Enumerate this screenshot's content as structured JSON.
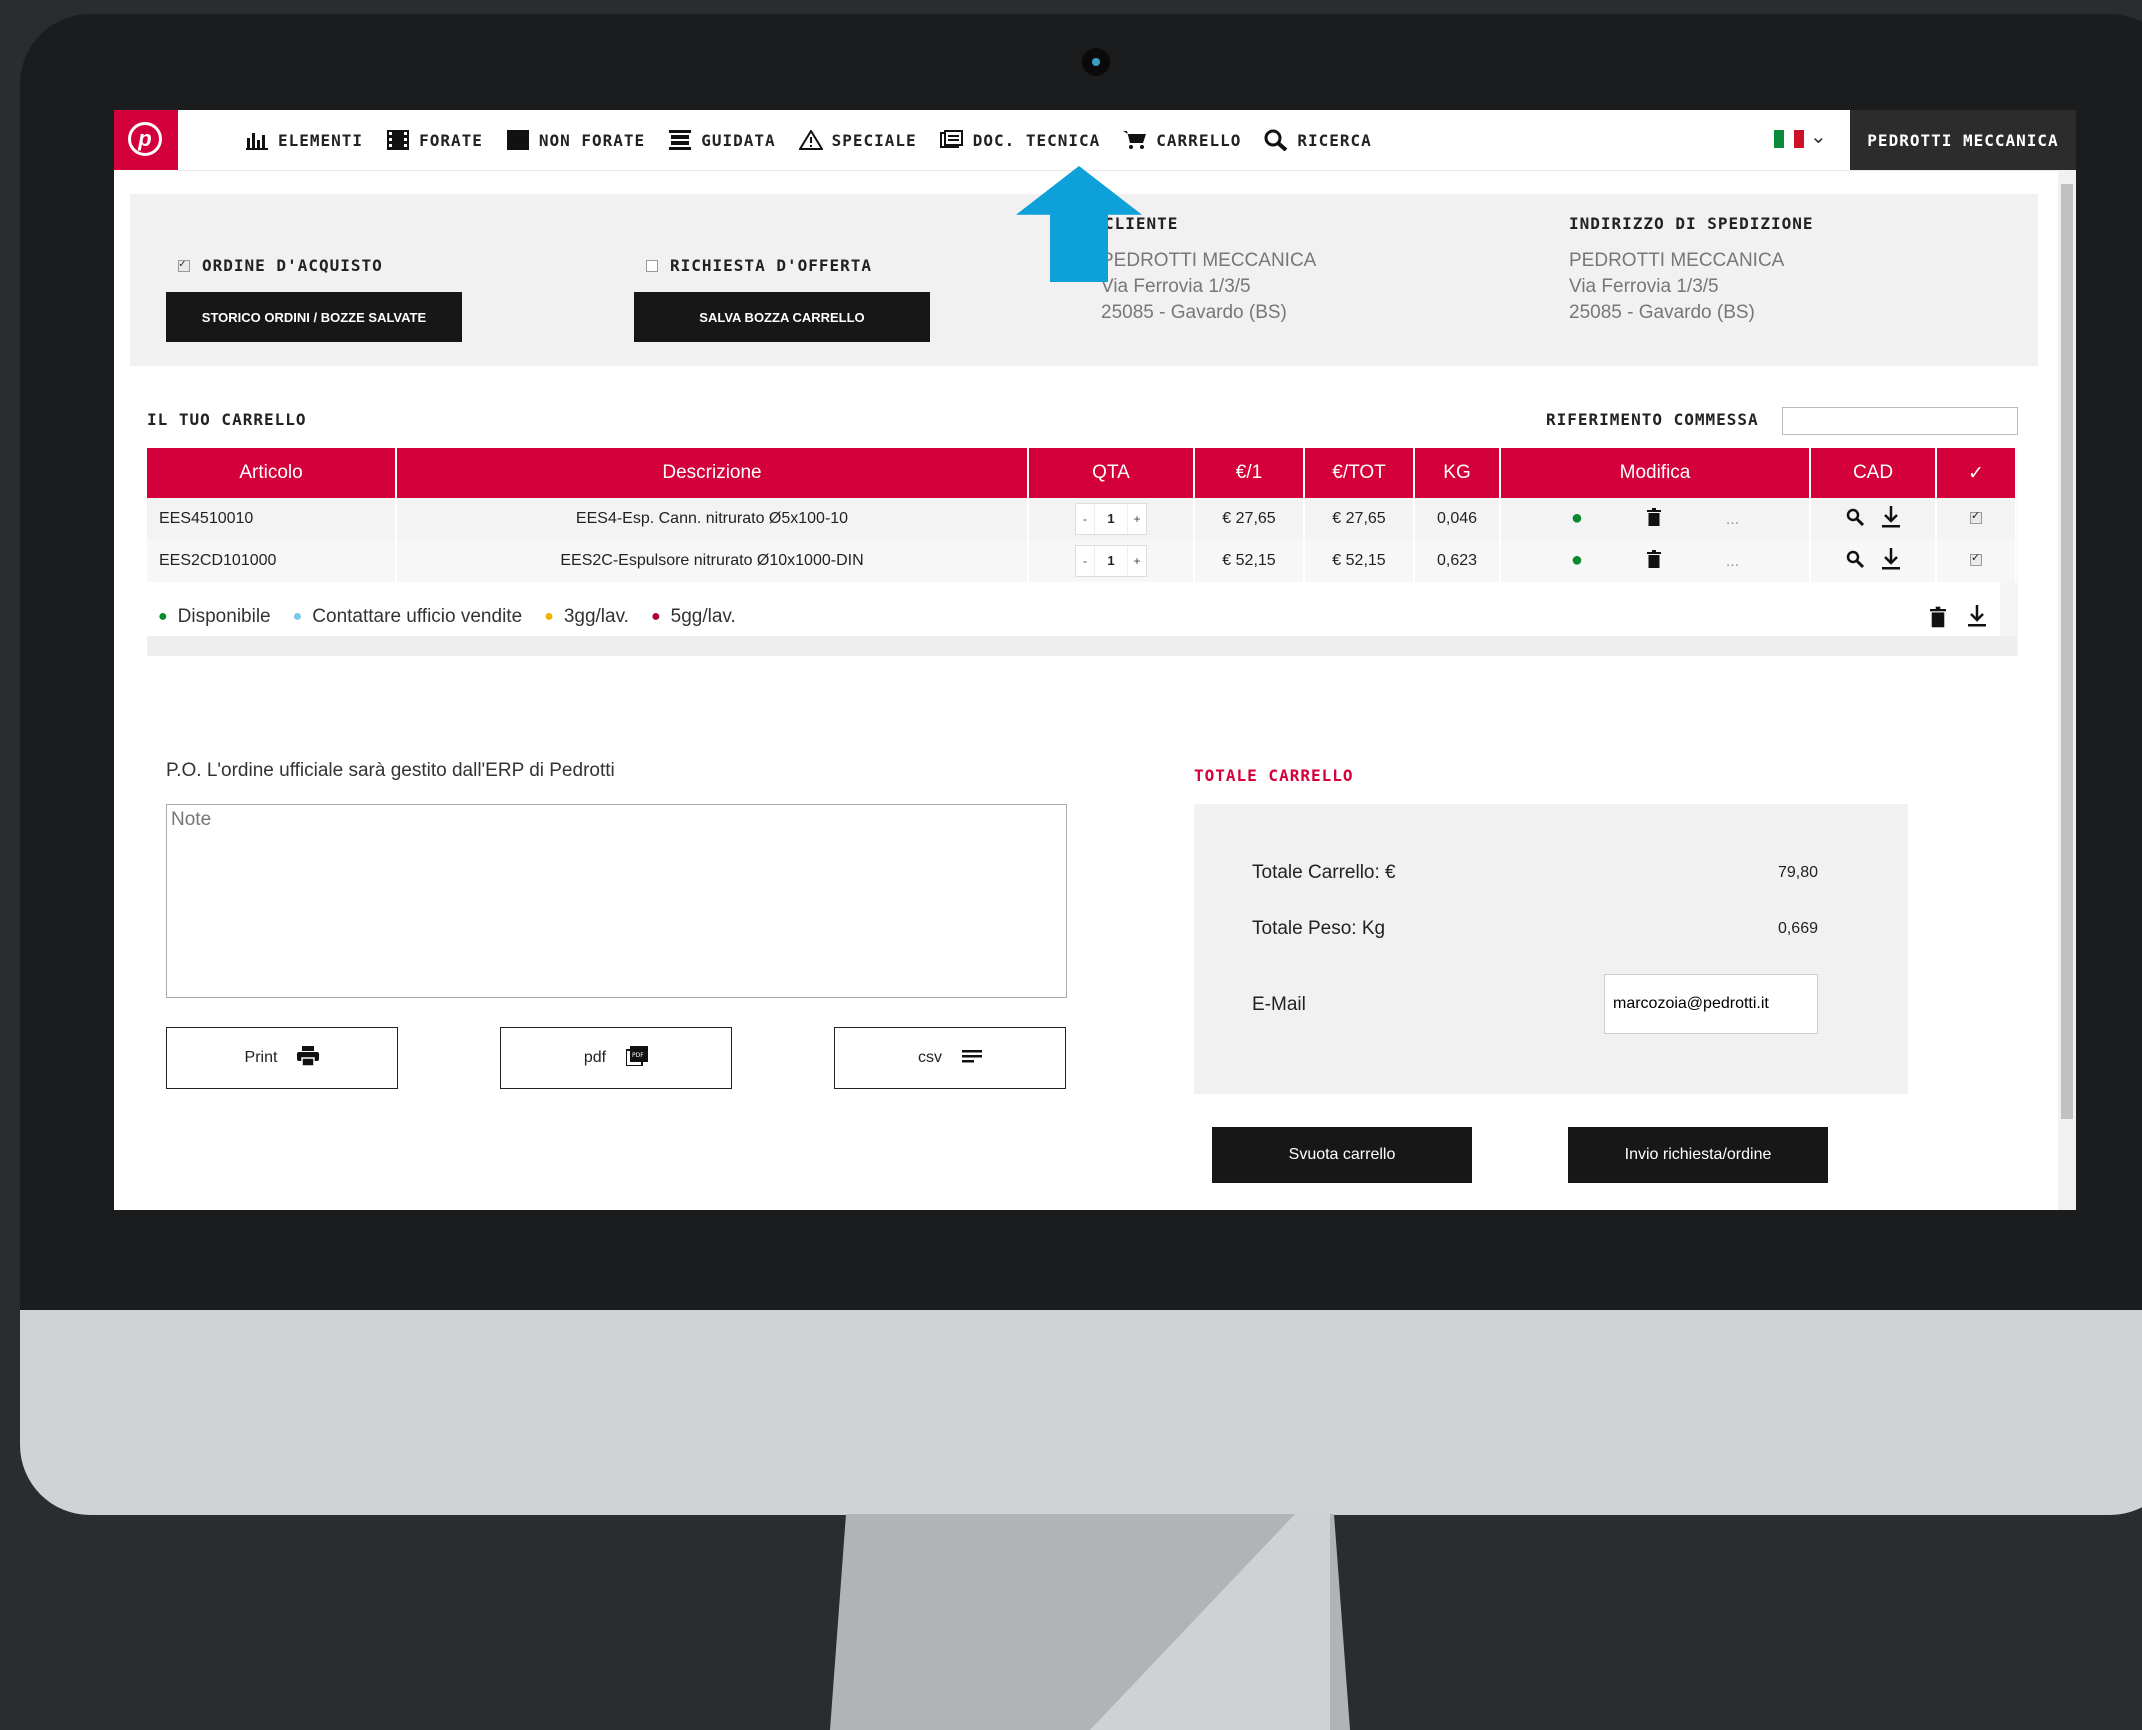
{
  "nav": {
    "items": [
      {
        "label": "Elementi",
        "icon": "chart-icon"
      },
      {
        "label": "Forate",
        "icon": "film-icon"
      },
      {
        "label": "Non forate",
        "icon": "square-icon"
      },
      {
        "label": "Guidata",
        "icon": "stack-icon"
      },
      {
        "label": "Speciale",
        "icon": "warning-icon"
      },
      {
        "label": "Doc. tecnica",
        "icon": "document-icon"
      },
      {
        "label": "Carrello",
        "icon": "cart-icon"
      },
      {
        "label": "Ricerca",
        "icon": "search-icon"
      }
    ],
    "user": "Pedrotti Meccanica"
  },
  "order_options": {
    "purchase_order_label": "Ordine d'acquisto",
    "purchase_order_checked": true,
    "offer_request_label": "Richiesta d'offerta",
    "offer_request_checked": false,
    "history_button": "STORICO ORDINI / BOZZE SALVATE",
    "save_draft_button": "SALVA BOZZA CARRELLO"
  },
  "client": {
    "heading": "Cliente",
    "name": "PEDROTTI MECCANICA",
    "street": "Via Ferrovia 1/3/5",
    "city": "25085 - Gavardo (BS)"
  },
  "shipping": {
    "heading": "Indirizzo di spedizione",
    "name": "PEDROTTI MECCANICA",
    "street": "Via Ferrovia 1/3/5",
    "city": "25085 - Gavardo (BS)"
  },
  "cart": {
    "title": "Il tuo carrello",
    "reference_label": "Riferimento commessa",
    "reference_value": "",
    "columns": [
      "Articolo",
      "Descrizione",
      "QTA",
      "€/1",
      "€/TOT",
      "KG",
      "Modifica",
      "CAD",
      "✓"
    ],
    "rows": [
      {
        "code": "EES4510010",
        "description": "EES4-Esp. Cann. nitrurato Ø5x100-10",
        "qty": "1",
        "unit": "€ 27,65",
        "total": "€ 27,65",
        "kg": "0,046",
        "more": "..."
      },
      {
        "code": "EES2CD101000",
        "description": "EES2C-Espulsore nitrurato Ø10x1000-DIN",
        "qty": "1",
        "unit": "€ 52,15",
        "total": "€ 52,15",
        "kg": "0,623",
        "more": "..."
      }
    ],
    "legend": [
      {
        "label": "Disponibile",
        "color": "#0a8a2e"
      },
      {
        "label": "Contattare ufficio vendite",
        "color": "#7cc6ea"
      },
      {
        "label": "3gg/lav.",
        "color": "#f2b300"
      },
      {
        "label": "5gg/lav.",
        "color": "#b0002b"
      }
    ]
  },
  "po": {
    "message": "P.O. L'ordine ufficiale sarà gestito dall'ERP di Pedrotti",
    "note_placeholder": "Note",
    "print_label": "Print",
    "pdf_label": "pdf",
    "csv_label": "csv"
  },
  "totals": {
    "heading": "Totale carrello",
    "cart_total_label": "Totale Carrello: €",
    "cart_total_value": "79,80",
    "weight_label": "Totale Peso: Kg",
    "weight_value": "0,669",
    "email_label": "E-Mail",
    "email_value": "marcozoia@pedrotti.it"
  },
  "actions": {
    "empty_cart": "Svuota carrello",
    "send": "Invio richiesta/ordine"
  },
  "colors": {
    "brand": "#d4003b",
    "arrow": "#0ea0d8"
  }
}
